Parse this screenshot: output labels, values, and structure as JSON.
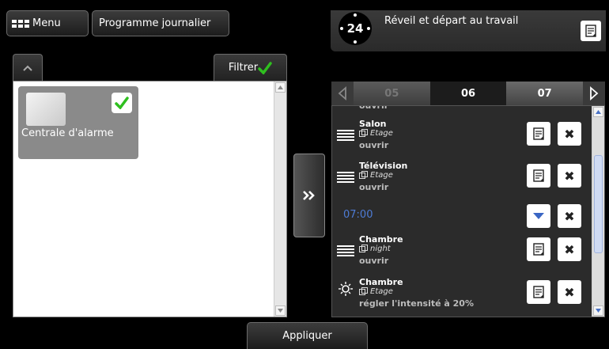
{
  "top": {
    "menu_label": "Menu",
    "programme_label": "Programme journalier"
  },
  "scenario": {
    "clock_label": "24",
    "title": "Réveil et départ au travail"
  },
  "left": {
    "filter_label": "Filtrer",
    "tile_label": "Centrale d'alarme"
  },
  "days": {
    "prev": "05",
    "current": "06",
    "next": "07"
  },
  "schedule": {
    "partial_top": "ouvrir",
    "items": [
      {
        "name": "Salon",
        "scope": "Etage",
        "action": "ouvrir",
        "icon": "blind-icon"
      },
      {
        "name": "Télévision",
        "scope": "Etage",
        "action": "ouvrir",
        "icon": "blind-icon"
      },
      {
        "name": "Chambre",
        "scope": "night",
        "action": "ouvrir",
        "icon": "blind-icon"
      },
      {
        "name": "Chambre",
        "scope": "Etage",
        "action": "régler l'intensité à 20%",
        "icon": "light-icon"
      }
    ],
    "time": "07:00"
  },
  "footer": {
    "apply_label": "Appliquer"
  },
  "colors": {
    "check_green": "#2fbf1f",
    "time_blue": "#4e7cd6",
    "scroll_blue": "#4a72c6"
  }
}
